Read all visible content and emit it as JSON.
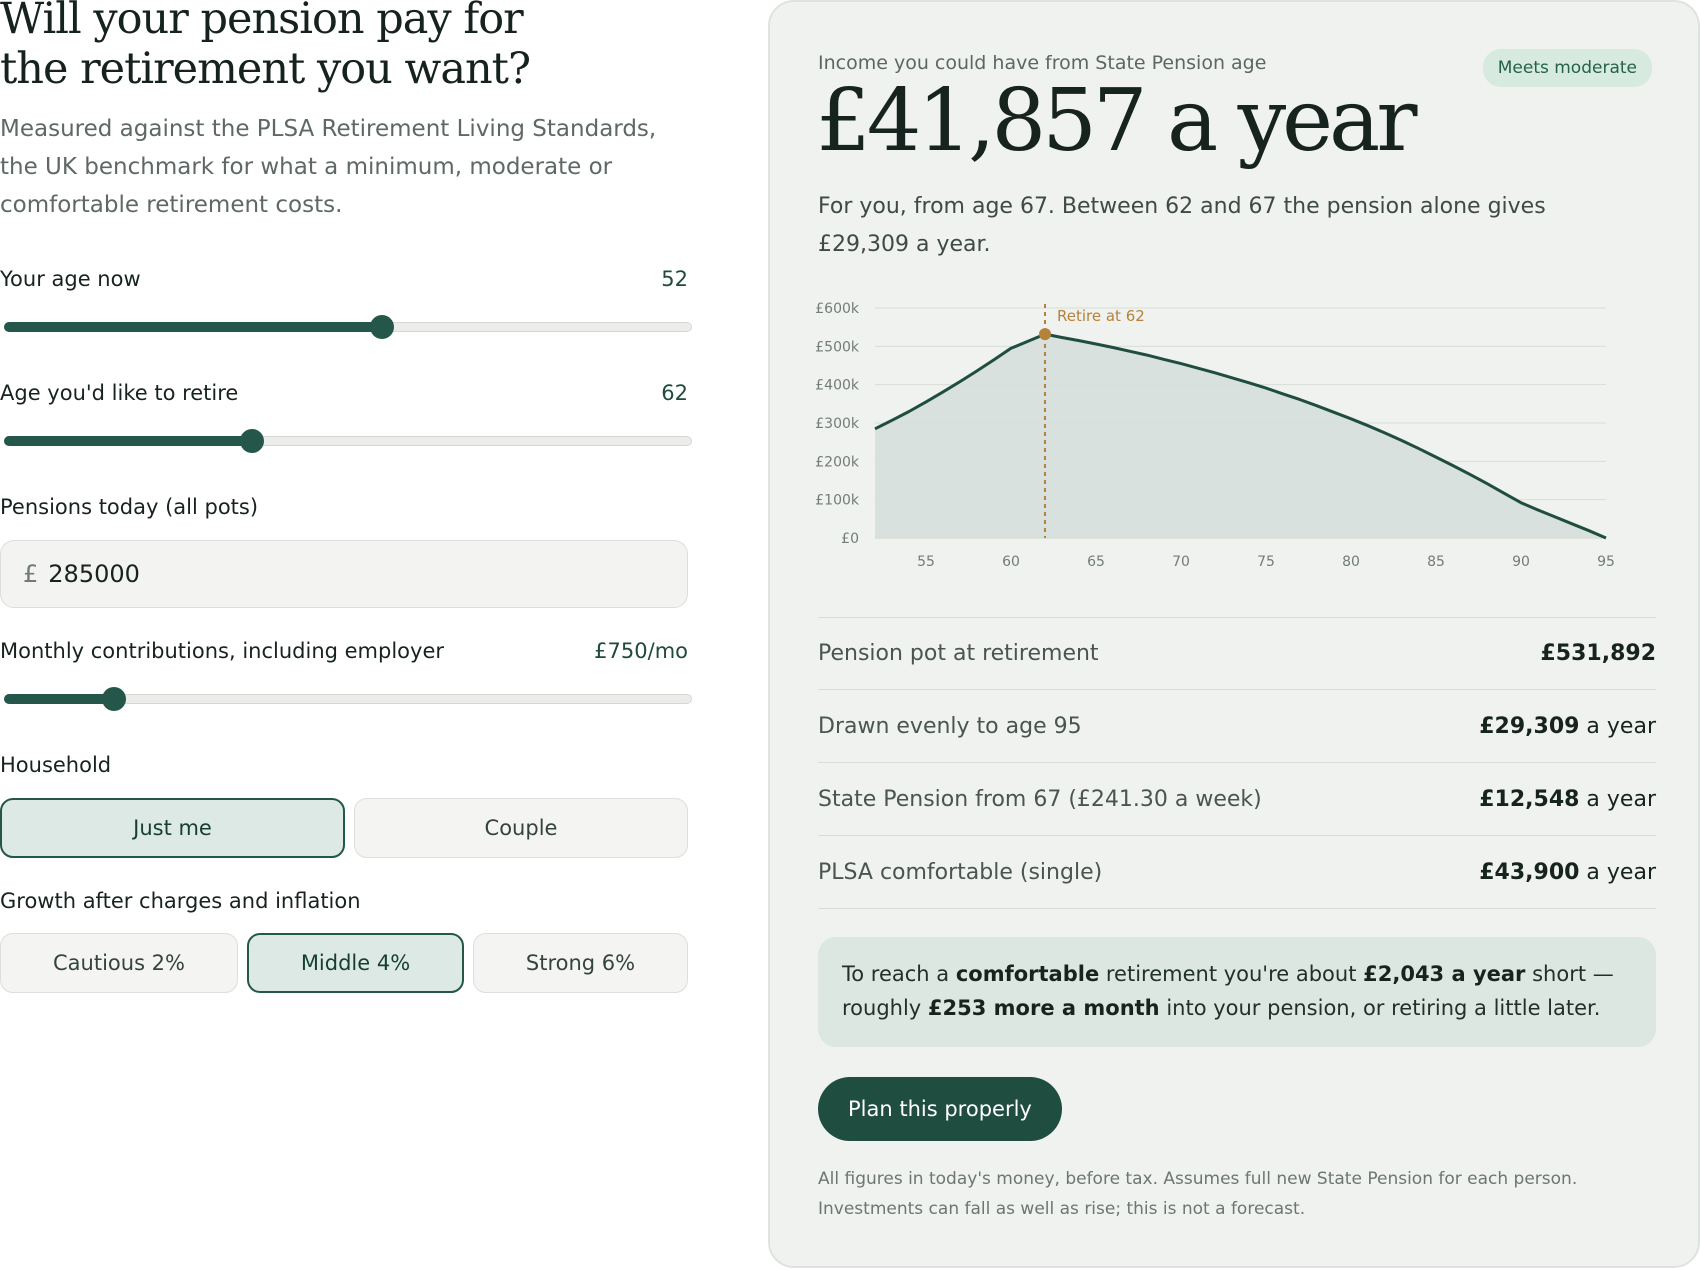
{
  "left": {
    "title": "Will your pension pay for\nthe retirement you want?",
    "intro": "Measured against the PLSA Retirement Living Standards, the UK benchmark for what a minimum, moderate or comfortable retirement costs.",
    "age_now": {
      "label": "Your age now",
      "value": "52",
      "fraction": 0.55
    },
    "retire_age": {
      "label": "Age you'd like to retire",
      "value": "62",
      "fraction": 0.36
    },
    "pensions": {
      "label": "Pensions today (all pots)",
      "currency": "£",
      "value": "285000"
    },
    "contrib": {
      "label": "Monthly contributions, including employer",
      "value": "£750/mo",
      "fraction": 0.16
    },
    "household": {
      "label": "Household",
      "options": [
        "Just me",
        "Couple"
      ],
      "selected": "Just me"
    },
    "growth": {
      "label": "Growth after charges and inflation",
      "options": [
        "Cautious 2%",
        "Middle 4%",
        "Strong 6%"
      ],
      "selected": "Middle 4%"
    }
  },
  "panel": {
    "kicker": "Income you could have from State Pension age",
    "badge": "Meets moderate",
    "headline": "£41,857 a year",
    "subtext": "For you, from age 67. Between 62 and 67 the pension alone gives £29,309 a year.",
    "rows": [
      {
        "label": "Pension pot at retirement",
        "value": "£531,892",
        "suffix": ""
      },
      {
        "label": "Drawn evenly to age 95",
        "value": "£29,309",
        "suffix": " a year"
      },
      {
        "label": "State Pension from 67 (£241.30 a week)",
        "value": "£12,548",
        "suffix": " a year"
      },
      {
        "label": "PLSA comfortable (single)",
        "value": "£43,900",
        "suffix": " a year"
      }
    ],
    "note": {
      "t1": "To reach a ",
      "b1": "comfortable",
      "t2": " retirement you're about ",
      "b2": "£2,043 a year",
      "t3": " short — roughly ",
      "b3": "£253 more a month",
      "t4": " into your pension, or retiring a little later."
    },
    "cta": "Plan this properly",
    "footnote": "All figures in today's money, before tax. Assumes full new State Pension for each person. Investments can fall as well as rise; this is not a forecast."
  },
  "colors": {
    "accent": "#24574a",
    "marker": "#b5823a",
    "area": "#d5dfda",
    "badge_bg": "#d7eadf"
  },
  "chart_data": {
    "type": "area",
    "x": [
      52,
      53,
      54,
      55,
      56,
      57,
      58,
      59,
      60,
      61,
      62,
      63,
      64,
      65,
      66,
      67,
      68,
      69,
      70,
      71,
      72,
      73,
      74,
      75,
      76,
      77,
      78,
      79,
      80,
      81,
      82,
      83,
      84,
      85,
      86,
      87,
      88,
      89,
      90,
      91,
      92,
      93,
      94,
      95
    ],
    "series": [
      {
        "values": [
          285000,
          307000,
          330000,
          355000,
          381000,
          408000,
          436000,
          465000,
          495000,
          513000,
          531892,
          523000,
          515000,
          506000,
          497000,
          487000,
          477000,
          466000,
          455000,
          443000,
          431000,
          418000,
          405000,
          391000,
          376000,
          361000,
          345000,
          328000,
          311000,
          293000,
          274000,
          254000,
          233000,
          211000,
          189000,
          166000,
          142000,
          117000,
          92000,
          73000,
          55000,
          37000,
          19000,
          0
        ]
      }
    ],
    "xlim": [
      52,
      95
    ],
    "ylim": [
      0,
      600000
    ],
    "x_ticks": [
      55,
      60,
      65,
      70,
      75,
      80,
      85,
      90,
      95
    ],
    "y_ticks": [
      0,
      100000,
      200000,
      300000,
      400000,
      500000,
      600000
    ],
    "y_tick_labels": [
      "£0",
      "£100k",
      "£200k",
      "£300k",
      "£400k",
      "£500k",
      "£600k"
    ],
    "marker": {
      "x": 62,
      "y": 531892,
      "label": "Retire at 62"
    },
    "grid": true
  }
}
